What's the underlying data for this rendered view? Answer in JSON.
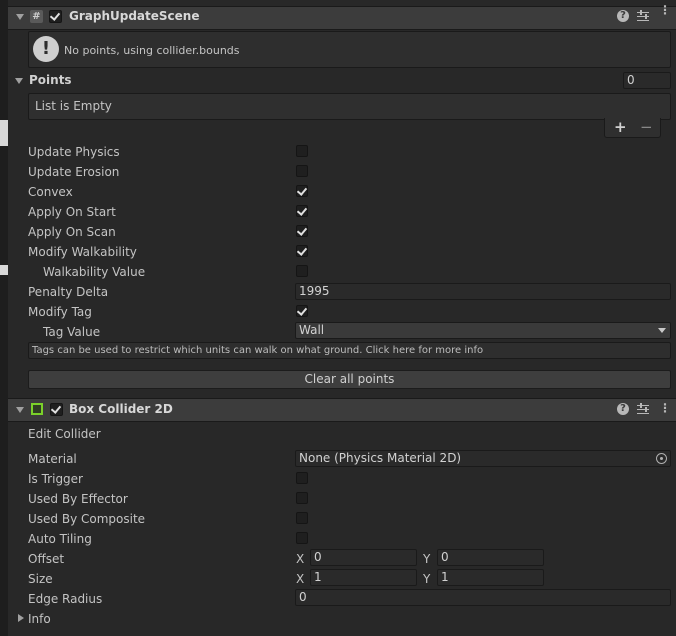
{
  "graph_update_scene": {
    "title": "GraphUpdateScene",
    "script_icon": "#",
    "help_text": "No points, using collider.bounds",
    "points_label": "Points",
    "points_count": "0",
    "list_empty": "List is Empty",
    "plus": "+",
    "minus": "−",
    "props": [
      {
        "label": "Update Physics",
        "checked": false
      },
      {
        "label": "Update Erosion",
        "checked": false
      },
      {
        "label": "Convex",
        "checked": true
      },
      {
        "label": "Apply On Start",
        "checked": true
      },
      {
        "label": "Apply On Scan",
        "checked": true
      },
      {
        "label": "Modify Walkability",
        "checked": true
      },
      {
        "label": "Walkability Value",
        "checked": false
      },
      {
        "label": "Penalty Delta",
        "value": "1995"
      },
      {
        "label": "Modify Tag",
        "checked": true
      },
      {
        "label": "Tag Value",
        "value": "Wall"
      }
    ],
    "tag_help": "Tags can be used to restrict which units can walk on what ground. Click here for more info",
    "clear_button": "Clear all points"
  },
  "box_collider": {
    "title": "Box Collider 2D",
    "edit_collider": "Edit Collider",
    "material_label": "Material",
    "material_value": "None (Physics Material 2D)",
    "is_trigger": "Is Trigger",
    "used_by_effector": "Used By Effector",
    "used_by_composite": "Used By Composite",
    "auto_tiling": "Auto Tiling",
    "offset_label": "Offset",
    "offset_x": "0",
    "offset_y": "0",
    "size_label": "Size",
    "size_x": "1",
    "size_y": "1",
    "x_axis": "X",
    "y_axis": "Y",
    "edge_radius_label": "Edge Radius",
    "edge_radius_value": "0",
    "info_label": "Info"
  },
  "header_icons": [
    "help-icon",
    "settings-sliders-icon",
    "more-options-icon"
  ],
  "colors": {
    "accent_green": "#7bd12a",
    "background": "#282828",
    "header": "#3c3c3c"
  }
}
